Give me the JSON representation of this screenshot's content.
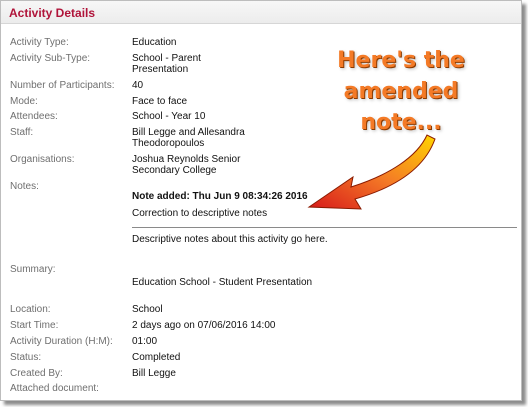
{
  "header": {
    "title": "Activity Details"
  },
  "fields": {
    "activity_type": {
      "label": "Activity Type:",
      "value": "Education"
    },
    "activity_subtype": {
      "label": "Activity Sub-Type:",
      "value_line1": "School - Parent",
      "value_line2": "Presentation"
    },
    "participants": {
      "label": "Number of Participants:",
      "value": "40"
    },
    "mode": {
      "label": "Mode:",
      "value": "Face to face"
    },
    "attendees": {
      "label": "Attendees:",
      "value": "School - Year 10"
    },
    "staff": {
      "label": "Staff:",
      "value_line1": "Bill Legge and Allesandra",
      "value_line2": "Theodoropoulos"
    },
    "organisations": {
      "label": "Organisations:",
      "value_line1": "Joshua Reynolds Senior",
      "value_line2": "Secondary College"
    },
    "notes": {
      "label": "Notes:",
      "note_added": "Note added: Thu Jun 9 08:34:26 2016",
      "correction": "Correction to descriptive notes",
      "original": "Descriptive notes about this activity go here."
    },
    "summary": {
      "label": "Summary:",
      "value": "Education School - Student Presentation"
    },
    "location": {
      "label": "Location:",
      "value": "School"
    },
    "start_time": {
      "label": "Start Time:",
      "value": "2 days ago on 07/06/2016 14:00"
    },
    "duration": {
      "label": "Activity Duration (H:M):",
      "value": "01:00"
    },
    "status": {
      "label": "Status:",
      "value": "Completed"
    },
    "created_by": {
      "label": "Created By:",
      "value": "Bill Legge"
    },
    "attached_document": {
      "label": "Attached document:"
    }
  },
  "annotation": {
    "line1": "Here's the",
    "line2": "amended",
    "line3": "note..."
  },
  "colors": {
    "title": "#b0143a",
    "annotation": "#f47a26",
    "arrow_start": "#ffd400",
    "arrow_end": "#d71a1a"
  }
}
